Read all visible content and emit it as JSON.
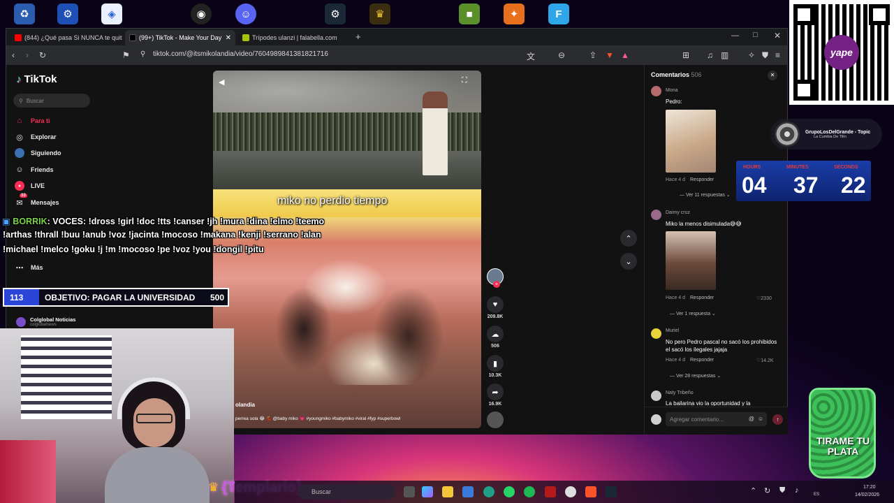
{
  "browser": {
    "tabs": [
      {
        "label": "(844) ¿Qué pasa Si NUNCA te quitas",
        "color": "#ff0000"
      },
      {
        "label": "(99+) TikTok - Make Your Day",
        "color": "#111111"
      },
      {
        "label": "Trípodes ulanzi | falabella.com",
        "color": "#a4c400"
      }
    ],
    "url": "tiktok.com/@itsmikolandia/video/7604989841381821716"
  },
  "tiktok": {
    "logo": "TikTok",
    "search_placeholder": "Buscar",
    "nav": [
      {
        "label": "Para ti",
        "icon": "home-icon"
      },
      {
        "label": "Explorar",
        "icon": "compass-icon"
      },
      {
        "label": "Siguiendo",
        "icon": "following-icon"
      },
      {
        "label": "Friends",
        "icon": "friends-icon"
      },
      {
        "label": "LIVE",
        "icon": "live-icon"
      },
      {
        "label": "Mensajes",
        "icon": "message-icon"
      },
      {
        "label": "Más",
        "icon": "more-icon"
      }
    ],
    "mensajes_badge": "33",
    "following_account": {
      "name": "Colglobal Noticias",
      "handle": "colglobalnews"
    },
    "video": {
      "caption_overlay": "miko no perdio tiempo",
      "author": "olandia",
      "description": "perrea sola 😂 💃 @baby miko 💗 #youngmiko #babymiko #viral #fyp #superbowl"
    },
    "actions": {
      "likes": "209.8K",
      "comments": "506",
      "saves": "10.3K",
      "shares": "16.9K"
    },
    "comments": {
      "title": "Comentarios",
      "count": "506",
      "items": [
        {
          "user": "Mona",
          "text": "Pedro:",
          "time": "Hace 4 d",
          "reply": "Responder",
          "likes": "",
          "replies": "Ver 11 respuestas"
        },
        {
          "user": "Daimy cruz",
          "text": "Miko la menos disimulada😅😅",
          "time": "Hace 4 d",
          "reply": "Responder",
          "likes": "2330",
          "replies": "Ver 1 respuesta"
        },
        {
          "user": "Muriel",
          "text": "No pero Pedro pascal no sacó los prohibidos el sacó los ilegales jajaja",
          "time": "Hace 4 d",
          "reply": "Responder",
          "likes": "14.2K",
          "replies": "Ver 28 respuestas"
        },
        {
          "user": "Naty Tribeño",
          "text": "La bailarina vio la oportunidad y la",
          "time": "",
          "reply": "",
          "likes": "",
          "replies": ""
        }
      ],
      "input_placeholder": "Agregar comentario..."
    }
  },
  "overlay": {
    "chat_user": "BORRIK",
    "chat_line1": ": VOCES: !dross !girl !doc !tts !canser !jh !mura !dina !elmo !teemo",
    "chat_line2": "!arthas !thrall !buu !anub !voz !jacinta !mocoso !makana !kenji !serrano !alan",
    "chat_line3": "!michael !melco !goku !j !m !mocoso !pe !voz !you !dongil !pitu",
    "goal": {
      "current": "113",
      "label": "OBJETIVO: PAGAR LA UNIVERSIDAD",
      "target": "500"
    },
    "music": {
      "artist": "GrupoLosDelGrande - Topic",
      "song": "La Cumbia De Tilín"
    },
    "timer": {
      "hours_label": "HOURS",
      "minutes_label": "MINUTES",
      "seconds_label": "SECONDS",
      "hours": "04",
      "minutes": "37",
      "seconds": "22"
    },
    "templario": "{Templario}",
    "tirame": "TIRAME TU PLATA",
    "yape": "yape"
  },
  "taskbar": {
    "search": "Buscar",
    "time": "17:20",
    "date": "14/02/2026",
    "lang": "ES"
  },
  "colors": {
    "tiktok_red": "#fe2c55",
    "timer_blue": "#1a3da8",
    "goal_border": "#ffffff"
  }
}
